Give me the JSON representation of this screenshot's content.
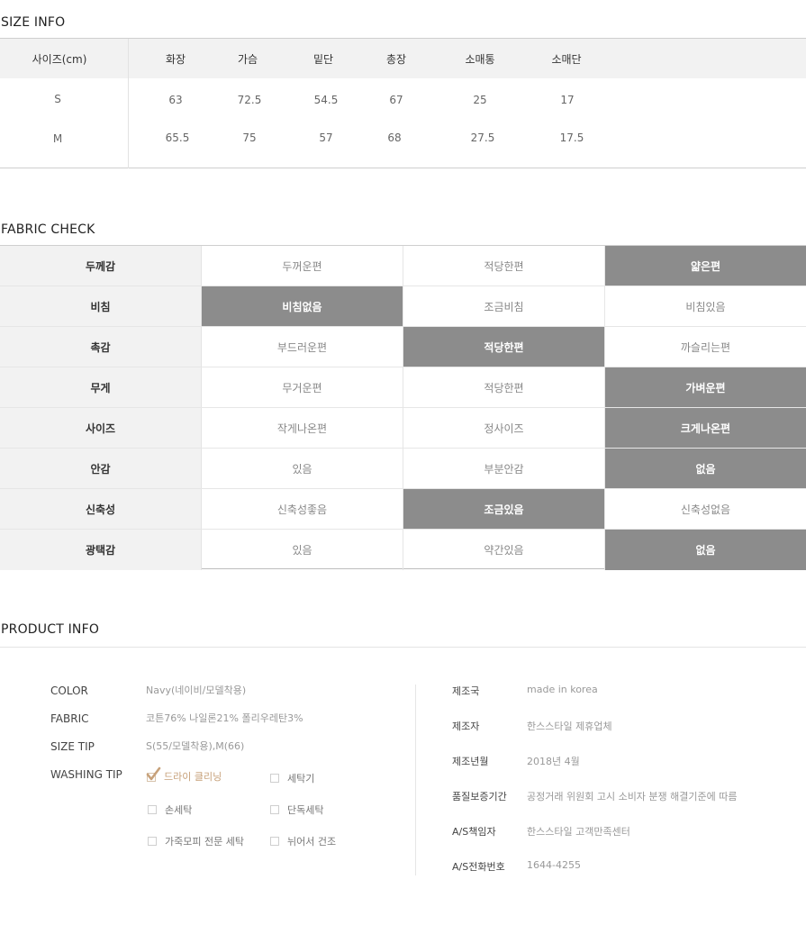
{
  "size_info": {
    "title": "SIZE INFO",
    "header_label": "사이즈(cm)",
    "columns": [
      "화장",
      "가슴",
      "밑단",
      "총장",
      "소매통",
      "소매단"
    ],
    "rows": [
      {
        "size": "S",
        "values": [
          "63",
          "72.5",
          "54.5",
          "67",
          "25",
          "17"
        ]
      },
      {
        "size": "M",
        "values": [
          "65.5",
          "75",
          "57",
          "68",
          "27.5",
          "17.5"
        ]
      }
    ]
  },
  "fabric_check": {
    "title": "FABRIC CHECK",
    "rows": [
      {
        "label": "두께감",
        "options": [
          "두꺼운편",
          "적당한편",
          "얇은편"
        ],
        "selected": 2
      },
      {
        "label": "비침",
        "options": [
          "비침없음",
          "조금비침",
          "비침있음"
        ],
        "selected": 0
      },
      {
        "label": "촉감",
        "options": [
          "부드러운편",
          "적당한편",
          "까슬리는편"
        ],
        "selected": 1
      },
      {
        "label": "무게",
        "options": [
          "무거운편",
          "적당한편",
          "가벼운편"
        ],
        "selected": 2
      },
      {
        "label": "사이즈",
        "options": [
          "작게나온편",
          "정사이즈",
          "크게나온편"
        ],
        "selected": 2
      },
      {
        "label": "안감",
        "options": [
          "있음",
          "부분안감",
          "없음"
        ],
        "selected": 2
      },
      {
        "label": "신축성",
        "options": [
          "신축성좋음",
          "조금있음",
          "신축성없음"
        ],
        "selected": 1
      },
      {
        "label": "광택감",
        "options": [
          "있음",
          "약간있음",
          "없음"
        ],
        "selected": 2
      }
    ]
  },
  "product_info": {
    "title": "PRODUCT INFO",
    "color_label": "COLOR",
    "color_value": "Navy(네이비/모델착용)",
    "fabric_label": "FABRIC",
    "fabric_value": "코튼76% 나일론21% 폴리우레탄3%",
    "sizetip_label": "SIZE TIP",
    "sizetip_value": "S(55/모델착용),M(66)",
    "washing_label": "WASHING TIP",
    "washing": [
      {
        "label": "드라이 클리닝",
        "checked": true
      },
      {
        "label": "세탁기",
        "checked": false
      },
      {
        "label": "손세탁",
        "checked": false
      },
      {
        "label": "단독세탁",
        "checked": false
      },
      {
        "label": "가죽모피 전문 세탁",
        "checked": false
      },
      {
        "label": "뉘어서 건조",
        "checked": false
      }
    ],
    "details": [
      {
        "label": "제조국",
        "value": "made in korea"
      },
      {
        "label": "제조자",
        "value": "한스스타일 제휴업체"
      },
      {
        "label": "제조년월",
        "value": "2018년 4월"
      },
      {
        "label": "품질보증기간",
        "value": "공정거래 위원회 고시 소비자 분쟁 해결기준에 따름"
      },
      {
        "label": "A/S책임자",
        "value": "한스스타일 고객만족센터"
      },
      {
        "label": "A/S전화번호",
        "value": "1644-4255"
      }
    ],
    "check_color": "#c7a17a"
  }
}
